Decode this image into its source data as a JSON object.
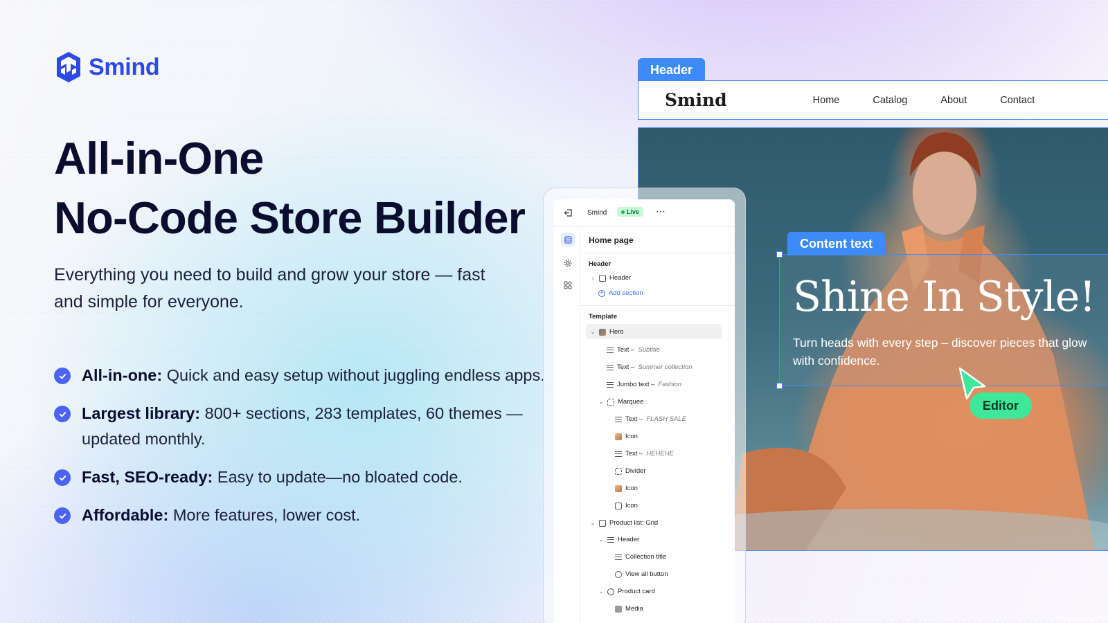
{
  "brand": {
    "name": "Smind",
    "color": "#2d49e6"
  },
  "headline": {
    "line1": "All-in-One",
    "line2": "No-Code Store Builder"
  },
  "subhead": "Everything you need to build and grow your store — fast and simple for everyone.",
  "features": [
    {
      "title": "All-in-one:",
      "text": " Quick and easy setup without juggling endless apps."
    },
    {
      "title": "Largest library:",
      "text": " 800+ sections, 283 templates, 60 themes —updated monthly."
    },
    {
      "title": "Fast, SEO-ready:",
      "text": " Easy to update—no bloated code."
    },
    {
      "title": "Affordable:",
      "text": " More features, lower cost."
    }
  ],
  "preview": {
    "header_tag": "Header",
    "content_tag": "Content text",
    "site_brand": "Smind",
    "nav": [
      "Home",
      "Catalog",
      "About",
      "Contact"
    ],
    "hero_title": "Shine In Style!",
    "hero_text": "Turn heads with every step – discover pieces that glow with confidence.",
    "editor_label": "Editor",
    "accent": "#3d8bf8",
    "editor_color": "#3fe79a"
  },
  "editor_panel": {
    "store_name": "Smind",
    "status": "Live",
    "page_title": "Home page",
    "header_section": "Header",
    "header_item": "Header",
    "add_section": "Add section",
    "template_section": "Template",
    "items": [
      {
        "label": "Hero",
        "sub": ""
      },
      {
        "label": "Text – ",
        "sub": "Subtitle"
      },
      {
        "label": "Text – ",
        "sub": "Summer collection"
      },
      {
        "label": "Jumbo text – ",
        "sub": "Fashion"
      },
      {
        "label": "Marquee",
        "sub": ""
      },
      {
        "label": "Text – ",
        "sub": "FLASH SALE"
      },
      {
        "label": "Icon",
        "sub": ""
      },
      {
        "label": "Text – ",
        "sub": "HEHEHE"
      },
      {
        "label": "Divider",
        "sub": ""
      },
      {
        "label": "Icon",
        "sub": ""
      },
      {
        "label": "Icon",
        "sub": ""
      },
      {
        "label": "Product list: Grid",
        "sub": ""
      },
      {
        "label": "Header",
        "sub": ""
      },
      {
        "label": "Collection title",
        "sub": ""
      },
      {
        "label": "View all button",
        "sub": ""
      },
      {
        "label": "Product card",
        "sub": ""
      },
      {
        "label": "Media",
        "sub": ""
      }
    ]
  }
}
